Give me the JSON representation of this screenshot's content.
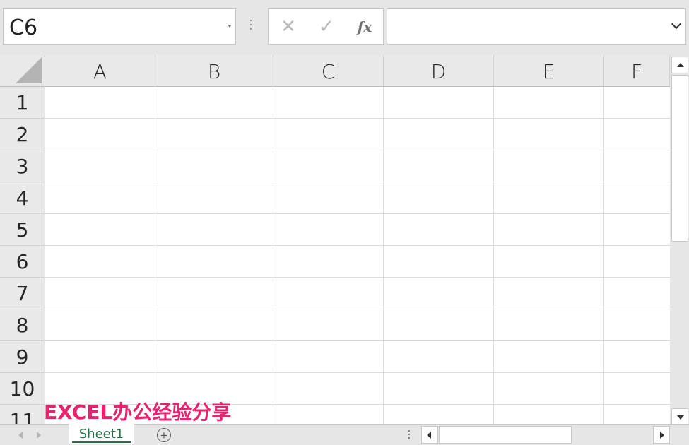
{
  "formula_bar": {
    "name_box_value": "C6",
    "cancel_glyph": "✕",
    "enter_glyph": "✓",
    "fx_label": "fx",
    "formula_value": ""
  },
  "grid": {
    "columns": [
      "A",
      "B",
      "C",
      "D",
      "E",
      "F"
    ],
    "rows": [
      "1",
      "2",
      "3",
      "4",
      "5",
      "6",
      "7",
      "8",
      "9",
      "10",
      "11"
    ]
  },
  "watermark": {
    "text": "EXCEL办公经验分享",
    "color": "#e8226e"
  },
  "sheets": {
    "tabs": [
      "Sheet1"
    ],
    "active": "Sheet1",
    "add_glyph": "+"
  },
  "colors": {
    "accent": "#217346",
    "header_bg": "#e9e9e9",
    "gridline": "#dadada"
  }
}
